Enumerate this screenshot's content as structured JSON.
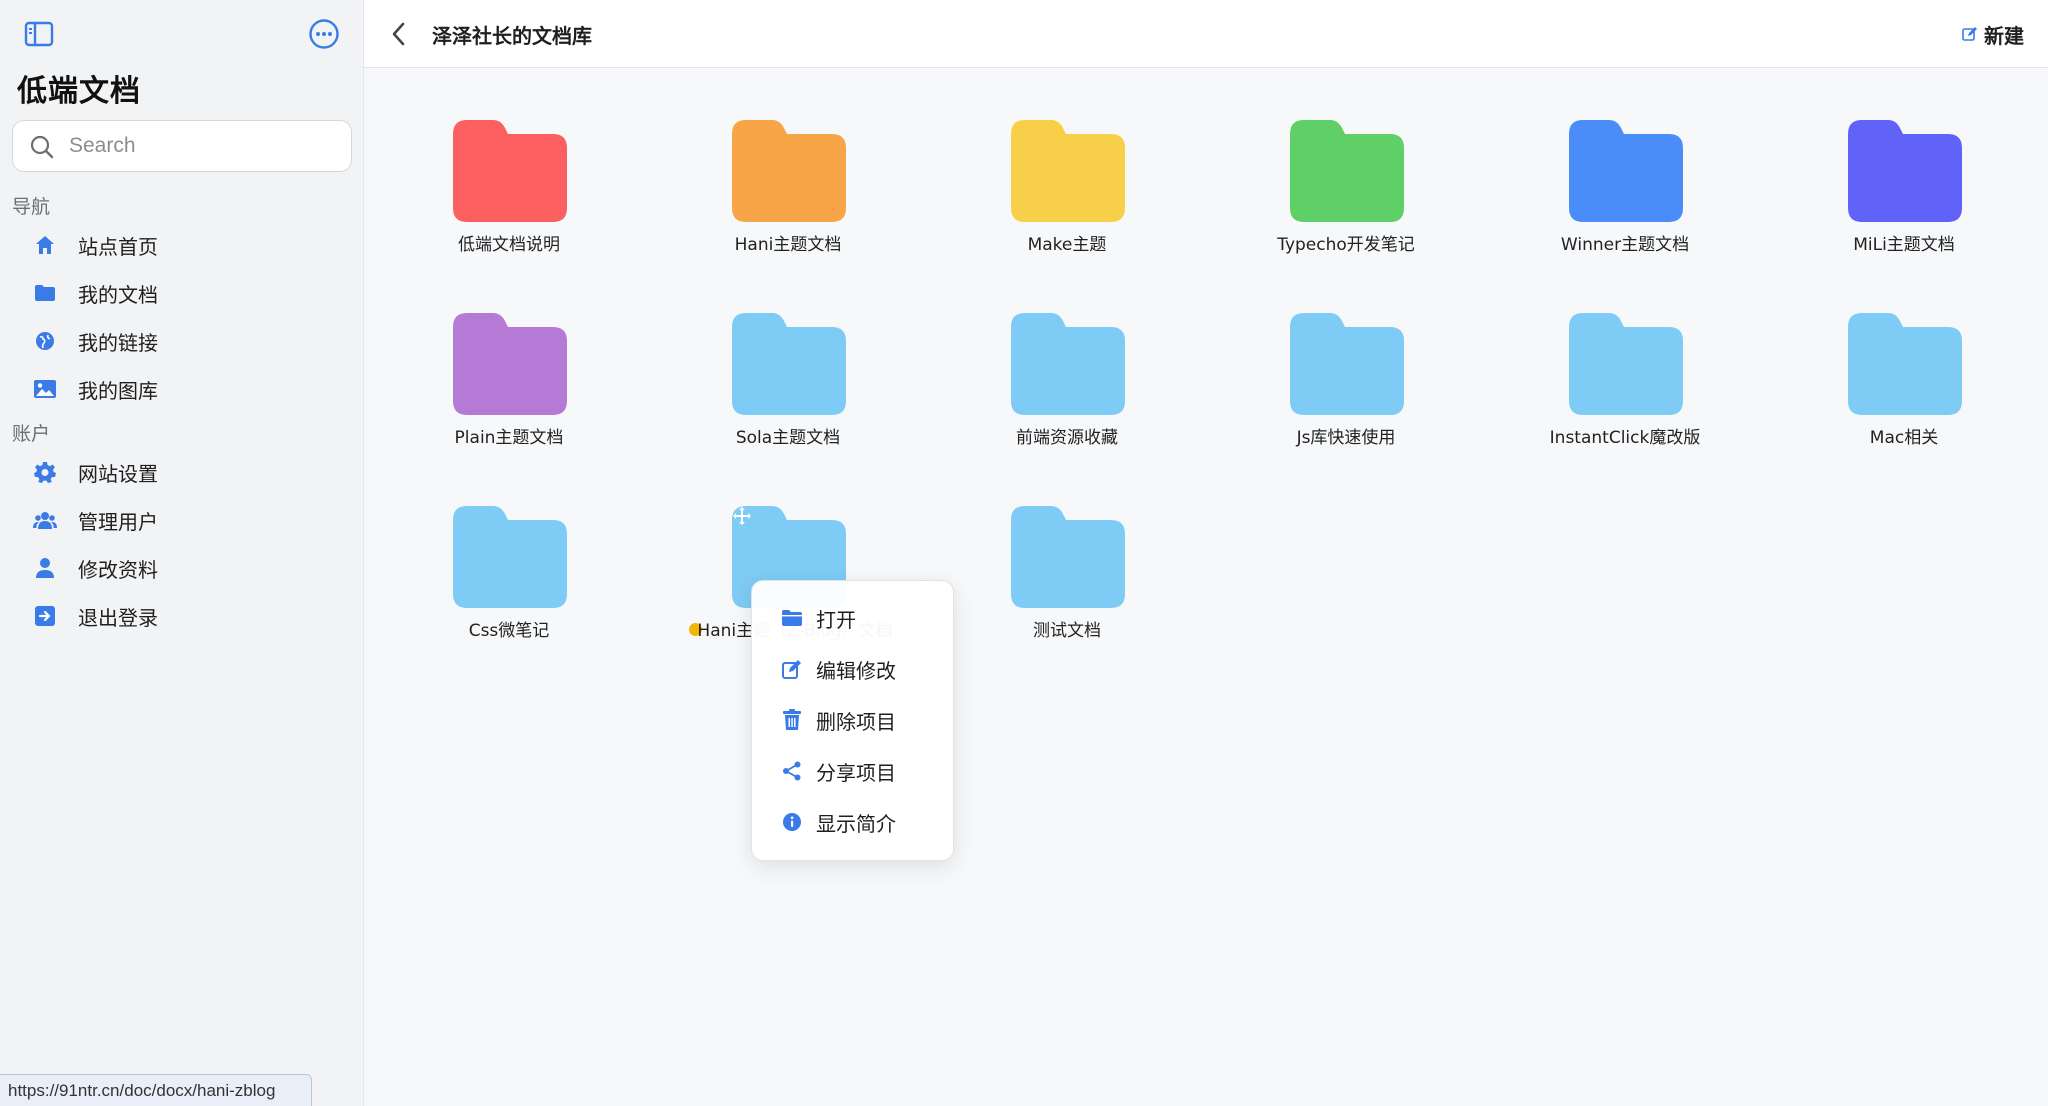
{
  "app": {
    "title": "低端文档"
  },
  "search": {
    "placeholder": "Search"
  },
  "sidebar": {
    "nav_label": "导航",
    "account_label": "账户",
    "nav_items": [
      {
        "label": "站点首页",
        "icon": "home-icon"
      },
      {
        "label": "我的文档",
        "icon": "folder-icon"
      },
      {
        "label": "我的链接",
        "icon": "globe-icon"
      },
      {
        "label": "我的图库",
        "icon": "image-icon"
      }
    ],
    "account_items": [
      {
        "label": "网站设置",
        "icon": "gear-icon"
      },
      {
        "label": "管理用户",
        "icon": "users-icon"
      },
      {
        "label": "修改资料",
        "icon": "user-icon"
      },
      {
        "label": "退出登录",
        "icon": "logout-icon"
      }
    ]
  },
  "header": {
    "title": "泽泽社长的文档库",
    "new_label": "新建"
  },
  "folders": [
    {
      "label": "低端文档说明",
      "color": "#fb5f5f"
    },
    {
      "label": "Hani主题文档",
      "color": "#f8a547"
    },
    {
      "label": "Make主题",
      "color": "#f8cf48"
    },
    {
      "label": "Typecho开发笔记",
      "color": "#5fcf67"
    },
    {
      "label": "Winner主题文档",
      "color": "#4b8df8"
    },
    {
      "label": "MiLi主题文档",
      "color": "#6162f8"
    },
    {
      "label": "Plain主题文档",
      "color": "#b57ad6"
    },
    {
      "label": "Sola主题文档",
      "color": "#7ecbf5"
    },
    {
      "label": "前端资源收藏",
      "color": "#7ecbf5"
    },
    {
      "label": "Js库快速使用",
      "color": "#7ecbf5"
    },
    {
      "label": "InstantClick魔改版",
      "color": "#7ecbf5"
    },
    {
      "label": "Mac相关",
      "color": "#7ecbf5"
    },
    {
      "label": "Css微笔记",
      "color": "#7ecbf5"
    },
    {
      "label": "Hani主题（Z-Blog）文档",
      "color": "#7ecbf5"
    },
    {
      "label": "测试文档",
      "color": "#7ecbf5"
    }
  ],
  "context_menu": [
    {
      "label": "打开",
      "icon": "folder-open-icon"
    },
    {
      "label": "编辑修改",
      "icon": "edit-icon"
    },
    {
      "label": "删除项目",
      "icon": "trash-icon"
    },
    {
      "label": "分享项目",
      "icon": "share-icon"
    },
    {
      "label": "显示简介",
      "icon": "info-icon"
    }
  ],
  "status_url": "https://91ntr.cn/doc/docx/hani-zblog",
  "colors": {
    "accent": "#3b7be8",
    "highlight_dot": "#f2b705"
  }
}
